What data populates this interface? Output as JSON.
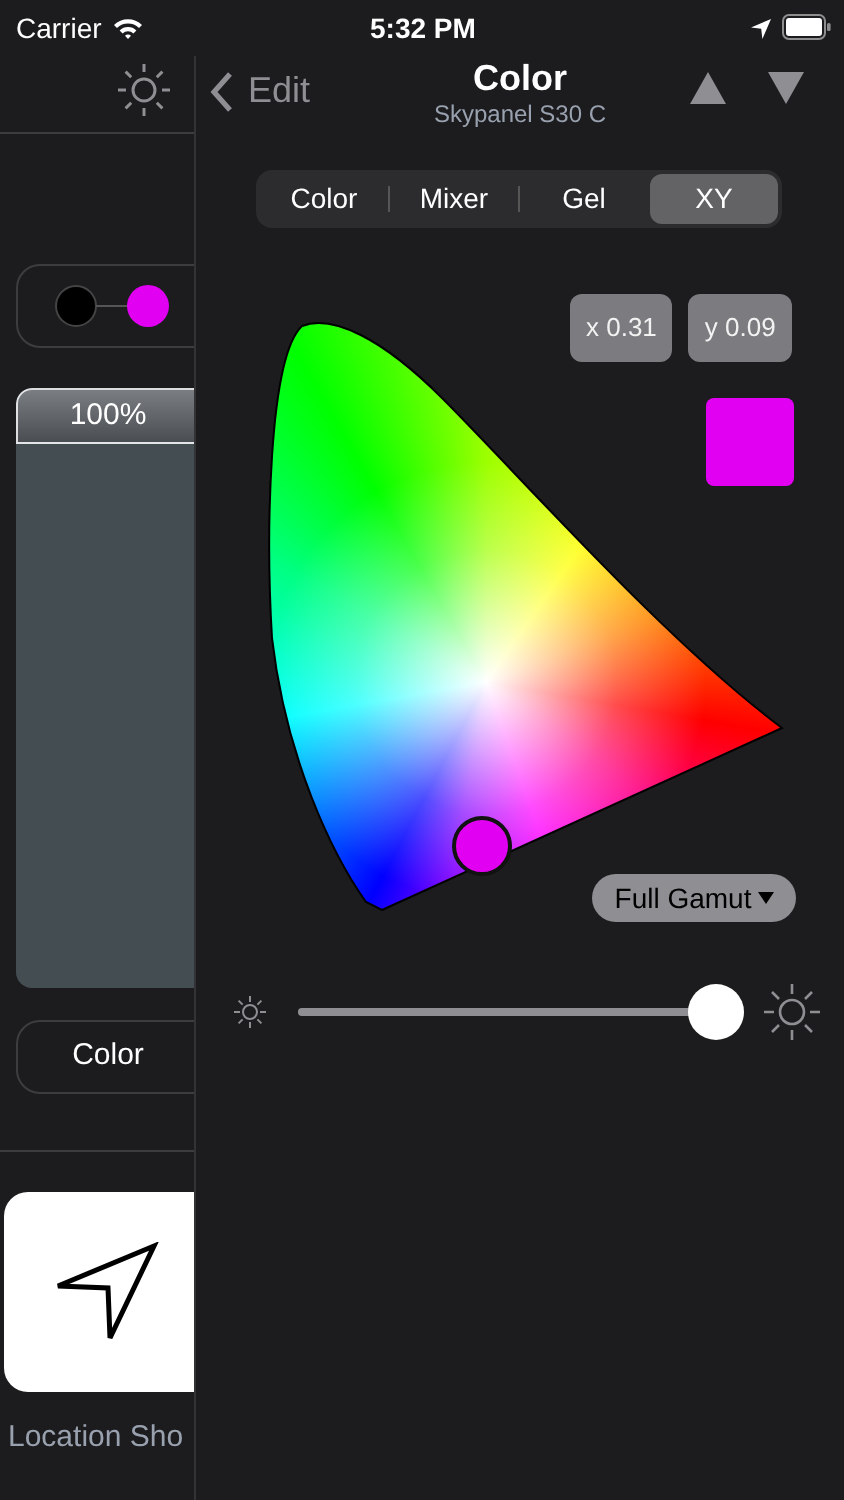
{
  "status_bar": {
    "carrier": "Carrier",
    "time": "5:32 PM"
  },
  "side_panel": {
    "intensity": {
      "label": "100%",
      "level": 1.0
    },
    "mode_button": "Color",
    "shortcut": {
      "label": "Location Sho"
    }
  },
  "navigation": {
    "back": "Edit",
    "title": "Color",
    "subtitle": "Skypanel S30 C"
  },
  "tabs": [
    {
      "label": "Color",
      "selected": false
    },
    {
      "label": "Mixer",
      "selected": false
    },
    {
      "label": "Gel",
      "selected": false
    },
    {
      "label": "XY",
      "selected": true
    }
  ],
  "coordinates": [
    "x 0.31",
    "y 0.09"
  ],
  "selected_color": {
    "color": "#e100f2"
  },
  "gamut_button": "Full Gamut",
  "brightness": {
    "level": 0.94
  }
}
